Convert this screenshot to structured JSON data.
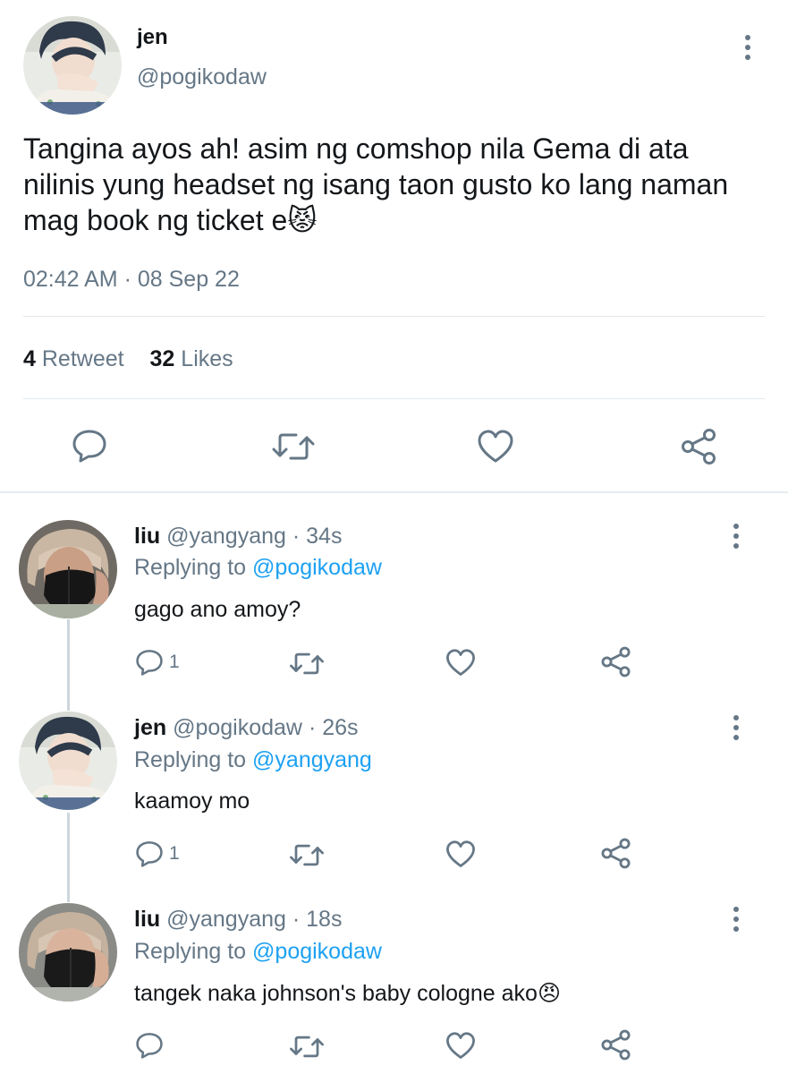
{
  "main_tweet": {
    "name": "jen",
    "handle": "@pogikodaw",
    "text": "Tangina ayos ah! asim ng comshop nila Gema di ata nilinis yung headset ng isang taon gusto ko lang naman mag book ng ticket e",
    "emoji": "😾",
    "time": "02:42 AM",
    "date": "08 Sep 22",
    "separator": " · ",
    "retweet_count": "4",
    "retweet_label": "Retweet",
    "likes_count": "32",
    "likes_label": "Likes"
  },
  "replies": [
    {
      "name": "liu",
      "handle": "@yangyang",
      "meta": " · 34s",
      "replying_label": "Replying to",
      "replying_to": "@pogikodaw",
      "text": "gago ano amoy?",
      "emoji": "",
      "reply_count": "1"
    },
    {
      "name": "jen",
      "handle": "@pogikodaw",
      "meta": " · 26s",
      "replying_label": "Replying to",
      "replying_to": "@yangyang",
      "text": "kaamoy mo",
      "emoji": "",
      "reply_count": "1"
    },
    {
      "name": "liu",
      "handle": "@yangyang",
      "meta": " · 18s",
      "replying_label": "Replying to",
      "replying_to": "@pogikodaw",
      "text": "tangek naka johnson's baby cologne ako",
      "emoji": "😠",
      "reply_count": ""
    }
  ],
  "colors": {
    "text": "#14171a",
    "muted": "#657786",
    "link": "#1da1f2",
    "divider": "#e1e8ed",
    "thread_line": "#ccd6dd"
  },
  "icons": {
    "reply": "speech-bubble-icon",
    "retweet": "retweet-arrows-icon",
    "like": "heart-outline-icon",
    "share": "share-nodes-icon",
    "more": "vertical-ellipsis-icon"
  }
}
